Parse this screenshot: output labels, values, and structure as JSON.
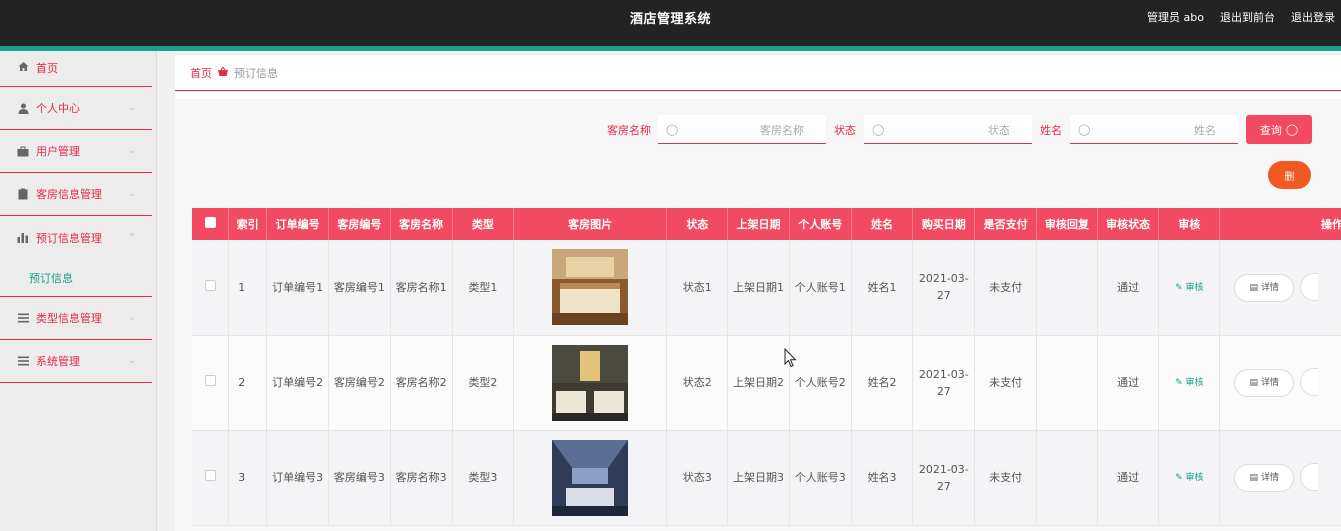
{
  "header": {
    "title": "酒店管理系统",
    "user": "管理员 abo",
    "to_front": "退出到前台",
    "logout": "退出登录"
  },
  "sidebar": {
    "items": [
      {
        "label": "首页",
        "icon": "home-icon"
      },
      {
        "label": "个人中心",
        "icon": "user-icon"
      },
      {
        "label": "用户管理",
        "icon": "briefcase-icon"
      },
      {
        "label": "客房信息管理",
        "icon": "clipboard-icon"
      },
      {
        "label": "预订信息管理",
        "icon": "bar-chart-icon"
      },
      {
        "label": "类型信息管理",
        "icon": "list-icon"
      },
      {
        "label": "系统管理",
        "icon": "list-icon"
      }
    ],
    "subitem": "预订信息"
  },
  "breadcrumb": {
    "home": "首页",
    "current": "预订信息"
  },
  "search": {
    "room_name_label": "客房名称",
    "room_name_placeholder": "客房名称",
    "status_label": "状态",
    "status_placeholder": "状态",
    "name_label": "姓名",
    "name_placeholder": "姓名",
    "query_button": "查询",
    "delete_button": "删"
  },
  "table": {
    "headers": [
      "索引",
      "订单编号",
      "客房编号",
      "客房名称",
      "类型",
      "客房图片",
      "状态",
      "上架日期",
      "个人账号",
      "姓名",
      "购买日期",
      "是否支付",
      "审核回复",
      "审核状态",
      "审核",
      "操作"
    ],
    "rows": [
      {
        "index": "1",
        "order_no": "订单编号1",
        "room_no": "客房编号1",
        "room_name": "客房名称1",
        "type": "类型1",
        "status": "状态1",
        "list_date": "上架日期1",
        "account": "个人账号1",
        "name": "姓名1",
        "buy_date": "2021-03-27",
        "paid": "未支付",
        "reply": "",
        "audit_status": "通过",
        "audit": "审核",
        "detail": "详情"
      },
      {
        "index": "2",
        "order_no": "订单编号2",
        "room_no": "客房编号2",
        "room_name": "客房名称2",
        "type": "类型2",
        "status": "状态2",
        "list_date": "上架日期2",
        "account": "个人账号2",
        "name": "姓名2",
        "buy_date": "2021-03-27",
        "paid": "未支付",
        "reply": "",
        "audit_status": "通过",
        "audit": "审核",
        "detail": "详情"
      },
      {
        "index": "3",
        "order_no": "订单编号3",
        "room_no": "客房编号3",
        "room_name": "客房名称3",
        "type": "类型3",
        "status": "状态3",
        "list_date": "上架日期3",
        "account": "个人账号3",
        "name": "姓名3",
        "buy_date": "2021-03-27",
        "paid": "未支付",
        "reply": "",
        "audit_status": "通过",
        "audit": "审核",
        "detail": "详情"
      }
    ]
  },
  "colors": {
    "accent": "#f24a62",
    "brand_teal": "#19a08f",
    "header_bg": "#232323",
    "delete_orange": "#f05a22"
  }
}
